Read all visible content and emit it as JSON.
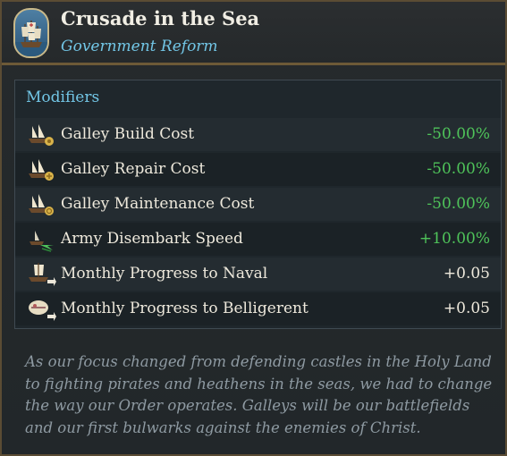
{
  "header": {
    "title": "Crusade in the Sea",
    "subtitle": "Government Reform",
    "emblem_icon": "sailing-ship-icon"
  },
  "modifiers": {
    "title": "Modifiers",
    "rows": [
      {
        "label": "Galley Build Cost",
        "value": "-50.00%",
        "icon": "galley-build-cost-icon",
        "tone": "neg"
      },
      {
        "label": "Galley Repair Cost",
        "value": "-50.00%",
        "icon": "galley-repair-cost-icon",
        "tone": "neg"
      },
      {
        "label": "Galley Maintenance Cost",
        "value": "-50.00%",
        "icon": "galley-maintenance-icon",
        "tone": "neg"
      },
      {
        "label": "Army Disembark Speed",
        "value": "+10.00%",
        "icon": "army-disembark-icon",
        "tone": "pos"
      },
      {
        "label": "Monthly Progress to Naval",
        "value": "+0.05",
        "icon": "naval-progress-icon",
        "tone": "neutral"
      },
      {
        "label": "Monthly Progress to Belligerent",
        "value": "+0.05",
        "icon": "belligerent-progress-icon",
        "tone": "neutral"
      }
    ]
  },
  "description": "As our focus changed from defending castles in the Holy Land to fighting pirates and heathens in the seas, we had to change the way our Order operates. Galleys will be our battlefields and our first bulwarks against the enemies of Christ.",
  "colors": {
    "accent_blue": "#72c6e6",
    "positive_green": "#4fc45a",
    "border_gold": "#6d5a37"
  }
}
